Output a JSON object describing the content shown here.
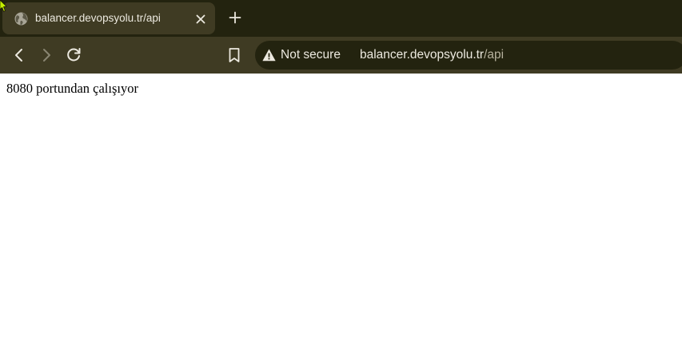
{
  "colors": {
    "tabstrip_bg": "#23230f",
    "toolbar_bg": "#3f3b23",
    "text_light": "#ece9df",
    "url_path": "#b6b19d"
  },
  "tab": {
    "title": "balancer.devopsyolu.tr/api",
    "favicon": "globe-icon"
  },
  "omnibox": {
    "security_label": "Not secure",
    "url_host": "balancer.devopsyolu.tr",
    "url_path": "/api"
  },
  "page": {
    "text": "8080 portundan çalışıyor"
  }
}
